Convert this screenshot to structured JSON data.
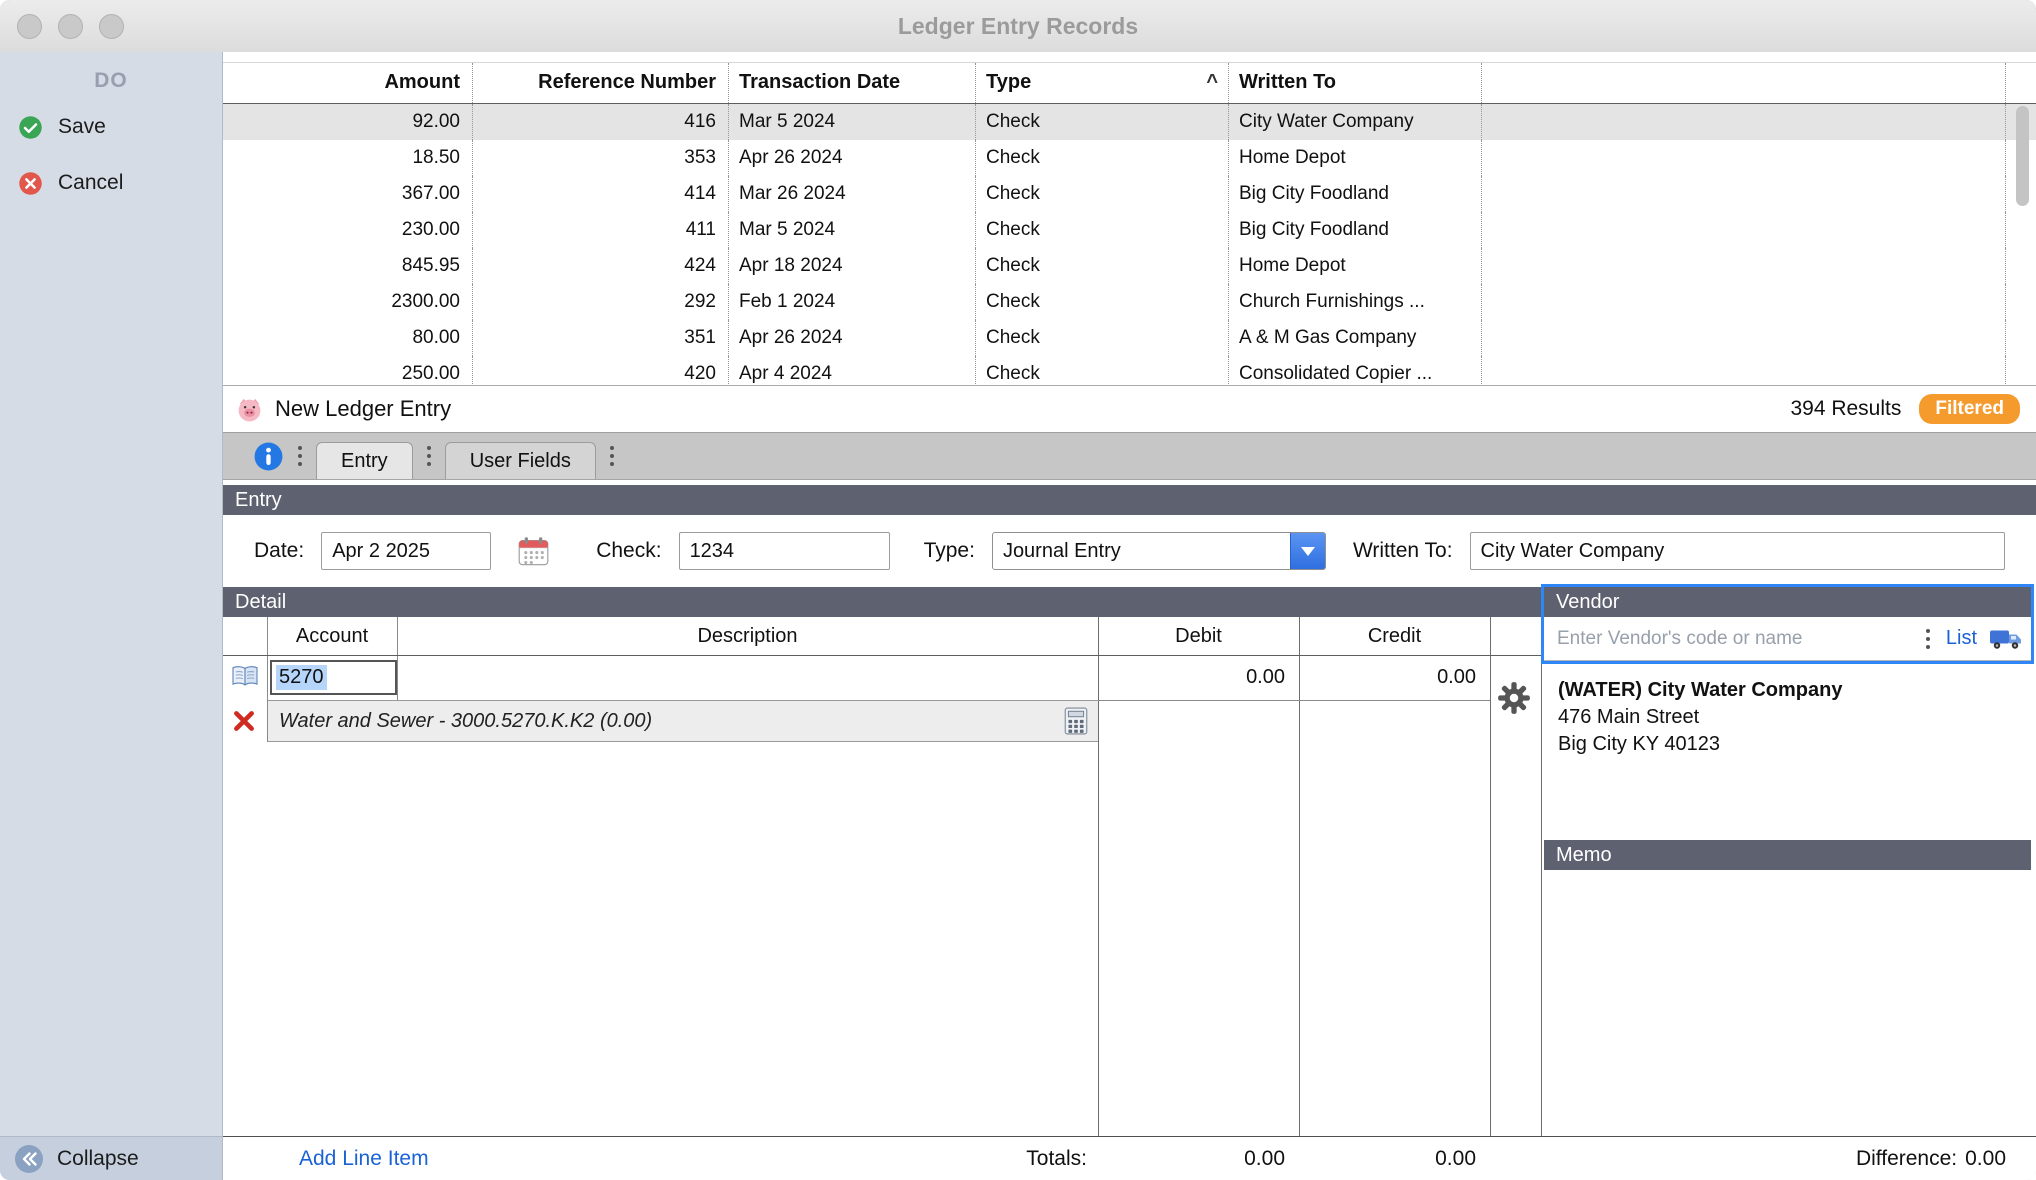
{
  "window": {
    "title": "Ledger Entry Records"
  },
  "sidebar": {
    "header": "DO",
    "save_label": "Save",
    "cancel_label": "Cancel",
    "collapse_label": "Collapse"
  },
  "ledger_table": {
    "columns": [
      "Amount",
      "Reference Number",
      "Transaction Date",
      "Type",
      "Written To"
    ],
    "sorted_column": "Type",
    "sort_indicator": "^",
    "rows": [
      {
        "amount": "92.00",
        "ref": "416",
        "date": "Mar 5 2024",
        "type": "Check",
        "written_to": "City Water Company",
        "selected": true
      },
      {
        "amount": "18.50",
        "ref": "353",
        "date": "Apr 26 2024",
        "type": "Check",
        "written_to": "Home Depot"
      },
      {
        "amount": "367.00",
        "ref": "414",
        "date": "Mar 26 2024",
        "type": "Check",
        "written_to": "Big City Foodland"
      },
      {
        "amount": "230.00",
        "ref": "411",
        "date": "Mar 5 2024",
        "type": "Check",
        "written_to": "Big City Foodland"
      },
      {
        "amount": "845.95",
        "ref": "424",
        "date": "Apr 18 2024",
        "type": "Check",
        "written_to": "Home Depot"
      },
      {
        "amount": "2300.00",
        "ref": "292",
        "date": "Feb 1 2024",
        "type": "Check",
        "written_to": "Church Furnishings ..."
      },
      {
        "amount": "80.00",
        "ref": "351",
        "date": "Apr 26 2024",
        "type": "Check",
        "written_to": "A & M Gas Company"
      },
      {
        "amount": "250.00",
        "ref": "420",
        "date": "Apr 4 2024",
        "type": "Check",
        "written_to": "Consolidated Copier ..."
      }
    ]
  },
  "status_bar": {
    "title": "New Ledger Entry",
    "results": "394 Results",
    "filter_badge": "Filtered"
  },
  "tab_bar": {
    "tabs": [
      {
        "label": "Entry",
        "active": true
      },
      {
        "label": "User Fields",
        "active": false
      }
    ]
  },
  "entry_form": {
    "header": "Entry",
    "date_label": "Date:",
    "date_value": "Apr 2 2025",
    "check_label": "Check:",
    "check_value": "1234",
    "type_label": "Type:",
    "type_value": "Journal Entry",
    "written_to_label": "Written To:",
    "written_to_value": "City Water Company"
  },
  "detail": {
    "header": "Detail",
    "account_col": "Account",
    "description_col": "Description",
    "debit_col": "Debit",
    "credit_col": "Credit",
    "line_account": "5270",
    "line_debit": "0.00",
    "line_credit": "0.00",
    "account_hint": "Water and Sewer - 3000.5270.K.K2 (0.00)",
    "add_line_label": "Add Line Item",
    "totals_label": "Totals:",
    "totals_debit": "0.00",
    "totals_credit": "0.00"
  },
  "vendor": {
    "header": "Vendor",
    "search_placeholder": "Enter Vendor's code or name",
    "list_label": "List",
    "name": "(WATER) City Water Company",
    "address1": "476 Main Street",
    "address2": "Big City KY 40123"
  },
  "memo": {
    "header": "Memo"
  },
  "footer": {
    "difference_label": "Difference:",
    "difference_value": "0.00"
  },
  "colors": {
    "accent_blue": "#2f86f6",
    "header_slate": "#5d6170",
    "filtered_badge": "#f59b2e",
    "selection_blue": "#b5d5fa"
  },
  "icons": {
    "pig-icon": "pig face app icon",
    "info-icon": "info circle",
    "calendar-icon": "calendar picker",
    "dropdown-icon": "down chevron",
    "truck-icon": "vendor delivery truck",
    "gear-icon": "line settings gear",
    "delete-line-icon": "red x",
    "ledger-line-icon": "open ledger book",
    "calculator-icon": "calculator",
    "save-icon": "green check circle",
    "cancel-icon": "red x circle",
    "collapse-icon": "double chevron left circle",
    "sort-icon": "caret"
  }
}
